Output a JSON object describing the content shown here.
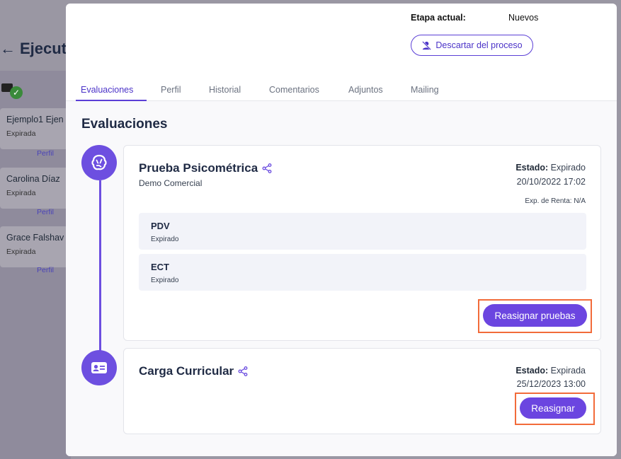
{
  "background": {
    "page_title": "Ejecutiv",
    "candidates": [
      {
        "name": "Ejemplo1 Ejen",
        "status": "Expirada",
        "link": "Perfil"
      },
      {
        "name": "Carolina Díaz",
        "status": "Expirada",
        "link": "Perfil"
      },
      {
        "name": "Grace Falshav",
        "status": "Expirada",
        "link": "Perfil"
      }
    ]
  },
  "modal": {
    "etapa_label": "Etapa actual:",
    "etapa_value": "Nuevos",
    "discard_label": "Descartar del proceso",
    "tabs": [
      {
        "label": "Evaluaciones",
        "active": true
      },
      {
        "label": "Perfil",
        "active": false
      },
      {
        "label": "Historial",
        "active": false
      },
      {
        "label": "Comentarios",
        "active": false
      },
      {
        "label": "Adjuntos",
        "active": false
      },
      {
        "label": "Mailing",
        "active": false
      }
    ],
    "section_title": "Evaluaciones",
    "evaluations": [
      {
        "icon": "brain-icon",
        "title": "Prueba Psicométrica",
        "subtitle": "Demo Comercial",
        "estado_label": "Estado:",
        "estado_value": "Expirado",
        "date": "20/10/2022 17:02",
        "renta": "Exp. de Renta: N/A",
        "tests": [
          {
            "name": "PDV",
            "status": "Expirado"
          },
          {
            "name": "ECT",
            "status": "Expirado"
          }
        ],
        "button": "Reasignar pruebas"
      },
      {
        "icon": "id-card-icon",
        "title": "Carga Curricular",
        "estado_label": "Estado:",
        "estado_value": "Expirada",
        "date": "25/12/2023 13:00",
        "button": "Reasignar"
      }
    ]
  },
  "colors": {
    "accent": "#6b45e0",
    "highlight": "#f26b3a",
    "title": "#1f2a44"
  }
}
